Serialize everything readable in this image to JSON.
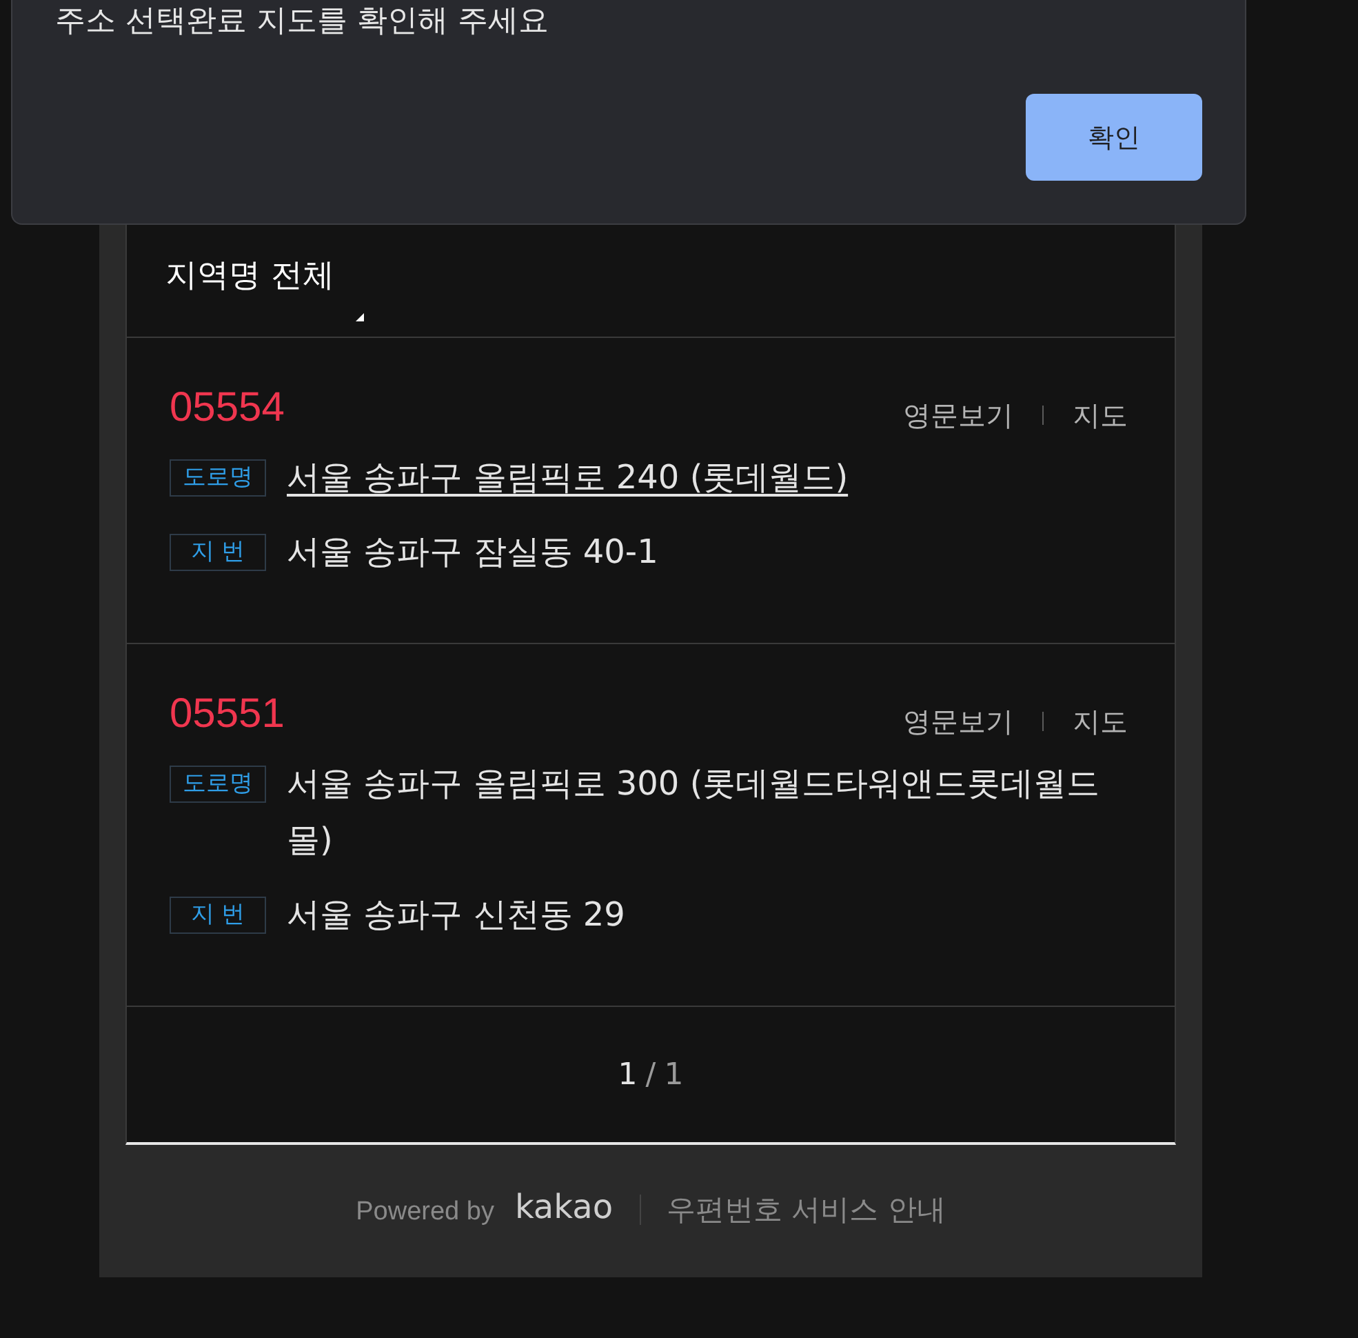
{
  "dialog": {
    "message": "주소 선택완료 지도를 확인해 주세요",
    "confirm_button": "확인"
  },
  "region_filter": {
    "label": "지역명 전체"
  },
  "results": [
    {
      "zipcode": "05554",
      "links": [
        "영문보기",
        "지도"
      ],
      "addresses": [
        {
          "tag": "도로명",
          "text": "서울 송파구 올림픽로 240 (롯데월드)",
          "underlined": true
        },
        {
          "tag": "지 번",
          "text": "서울 송파구 잠실동 40-1",
          "underlined": false
        }
      ]
    },
    {
      "zipcode": "05551",
      "links": [
        "영문보기",
        "지도"
      ],
      "addresses": [
        {
          "tag": "도로명",
          "text": "서울 송파구 올림픽로 300 (롯데월드타워앤드롯데월드몰)",
          "underlined": false
        },
        {
          "tag": "지 번",
          "text": "서울 송파구 신천동 29",
          "underlined": false
        }
      ]
    }
  ],
  "pagination": {
    "current": "1",
    "separator": "/",
    "total": "1"
  },
  "footer": {
    "powered_by": "Powered by",
    "logo": "kakao",
    "info_link": "우편번호 서비스 안내"
  }
}
